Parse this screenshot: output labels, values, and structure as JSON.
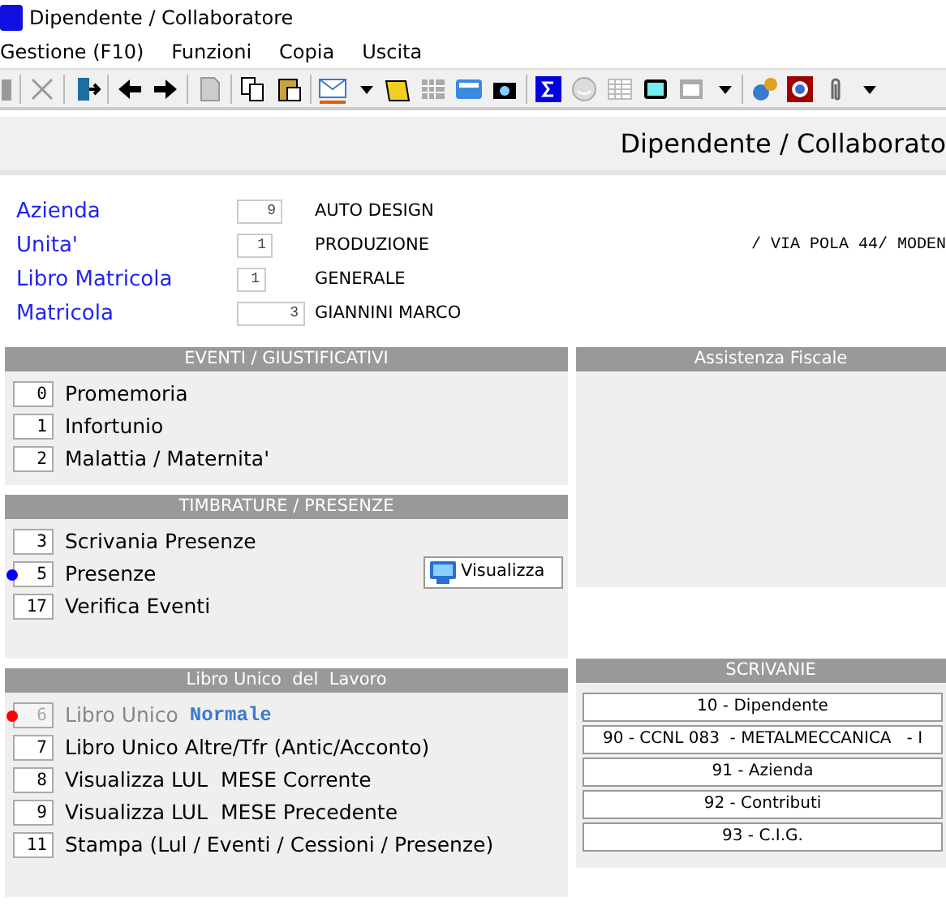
{
  "window": {
    "title": "Dipendente / Collaboratore"
  },
  "menu": [
    "Gestione (F10)",
    "Funzioni",
    "Copia",
    "Uscita"
  ],
  "header": {
    "title": "Dipendente / Collaborato"
  },
  "fields": [
    {
      "label": "Azienda",
      "code": "9",
      "description": "AUTO DESIGN"
    },
    {
      "label": "Unita'",
      "code": "1",
      "description": "PRODUZIONE",
      "address": "/ VIA POLA 44/ MODEN"
    },
    {
      "label": "Libro Matricola",
      "code": "1",
      "description": "GENERALE"
    },
    {
      "label": "Matricola",
      "code": "3",
      "description": "GIANNINI MARCO"
    }
  ],
  "eventi": {
    "title": "EVENTI / GIUSTIFICATIVI",
    "items": [
      {
        "code": "0",
        "label": "Promemoria"
      },
      {
        "code": "1",
        "label": "Infortunio"
      },
      {
        "code": "2",
        "label": "Malattia / Maternita'"
      }
    ]
  },
  "timbrature": {
    "title": "TIMBRATURE / PRESENZE",
    "button": "Visualizza",
    "items": [
      {
        "code": "3",
        "label": "Scrivania Presenze"
      },
      {
        "code": "5",
        "label": "Presenze",
        "color": "#0000ff"
      },
      {
        "code": "17",
        "label": "Verifica Eventi"
      }
    ]
  },
  "assistenza": {
    "title": "Assistenza Fiscale"
  },
  "libro": {
    "title": "Libro Unico  del  Lavoro",
    "items": [
      {
        "code": "6",
        "label": "Libro Unico",
        "mode": "Normale",
        "disabled": true,
        "color": "#ff0000"
      },
      {
        "code": "7",
        "label": "Libro Unico Altre/Tfr (Antic/Acconto)",
        "disabled": false
      },
      {
        "code": "8",
        "label": "Visualizza LUL  MESE Corrente",
        "disabled": false
      },
      {
        "code": "9",
        "label": "Visualizza LUL  MESE Precedente",
        "disabled": false
      },
      {
        "code": "11",
        "label": "Stampa (Lul / Eventi / Cessioni / Presenze)",
        "disabled": false
      }
    ]
  },
  "scrivanie": {
    "title": "SCRIVANIE",
    "buttons": [
      "10 - Dipendente",
      "90 - CCNL 083  - METALMECCANICA   - I",
      "91 - Azienda",
      "92 - Contributi",
      "93 - C.I.G."
    ]
  }
}
